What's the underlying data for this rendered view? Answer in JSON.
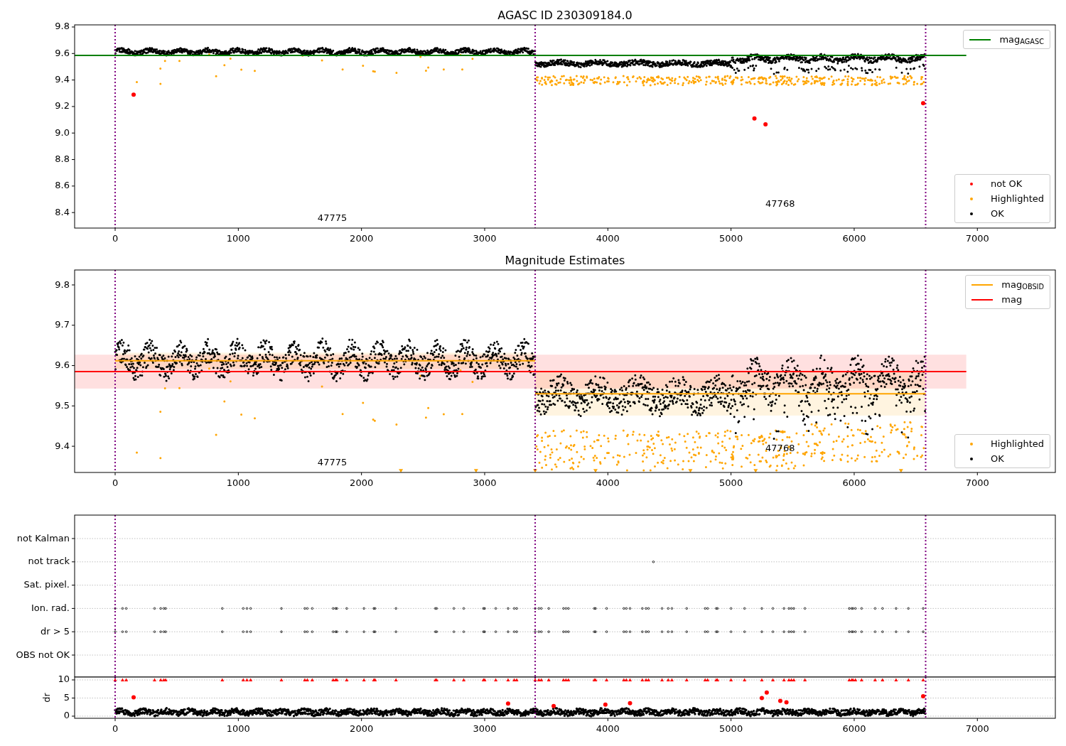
{
  "figure": {
    "panels": [
      {
        "kind": "magnitude",
        "chart_data": {
          "type": "scatter",
          "title": "AGASC ID 230309184.0",
          "xlim": [
            -329,
            7633
          ],
          "ylim": [
            8.283,
            9.816
          ],
          "xticks": [
            0,
            1000,
            2000,
            3000,
            4000,
            5000,
            6000,
            7000
          ],
          "yticks": [
            8.4,
            8.6,
            8.8,
            {
              "value": 9,
              "label": "9.0"
            },
            9.2,
            9.4,
            9.6,
            9.8
          ],
          "series": [
            {
              "type": "line",
              "color": "#008000",
              "x": [
                -329,
                6910
              ],
              "values": [
                9.585,
                9.585
              ]
            },
            {
              "color": "#ff0000",
              "x": [
                150,
                5190,
                5280,
                6560
              ],
              "values": [
                9.29,
                9.11,
                9.065,
                9.225
              ]
            }
          ],
          "ref_lines": [
            {
              "axis": "x",
              "value": 0,
              "color": "#800080"
            },
            {
              "axis": "x",
              "value": 3410,
              "color": "#800080"
            },
            {
              "axis": "x",
              "value": 6580,
              "color": "#800080"
            }
          ],
          "annotations": [
            "47775",
            "47768"
          ]
        },
        "legends": [
          {
            "items": [
              {
                "kind": "line",
                "label": "mag$_{AGASC}$",
                "color": "#008000"
              }
            ]
          },
          {
            "items": [
              {
                "kind": "point",
                "label": "not OK",
                "color": "#ff0000"
              },
              {
                "kind": "point",
                "label": "Highlighted",
                "color": "#ffa500"
              },
              {
                "kind": "point",
                "label": "OK",
                "color": "#000000"
              }
            ]
          }
        ]
      },
      {
        "kind": "estimates",
        "chart_data": {
          "type": "scatter",
          "title": "Magnitude Estimates",
          "xlim": [
            -329,
            7633
          ],
          "ylim": [
            9.335,
            9.837
          ],
          "xticks": [
            0,
            1000,
            2000,
            3000,
            4000,
            5000,
            6000,
            7000
          ],
          "yticks": [
            9.4,
            9.5,
            9.6,
            9.7,
            9.8
          ],
          "series": [
            {
              "type": "line",
              "color": "#ffa500",
              "x": [
                0,
                3410
              ],
              "values": [
                9.612,
                9.612
              ]
            },
            {
              "type": "line",
              "color": "#ffa500",
              "x": [
                3410,
                6580
              ],
              "values": [
                9.53,
                9.53
              ]
            },
            {
              "type": "line",
              "color": "#ff0000",
              "x": [
                -329,
                6910
              ],
              "values": [
                9.585,
                9.585
              ]
            }
          ],
          "bands": [
            {
              "axis": "y",
              "from": 9.592,
              "to": 9.632,
              "color": "#ffa500"
            },
            {
              "axis": "y",
              "from": 9.476,
              "to": 9.585,
              "color": "#ffa500"
            },
            {
              "axis": "y",
              "from": 9.543,
              "to": 9.627,
              "color": "#ff0000"
            }
          ],
          "ref_lines": [
            {
              "axis": "x",
              "value": 0,
              "color": "#800080"
            },
            {
              "axis": "x",
              "value": 3410,
              "color": "#800080"
            },
            {
              "axis": "x",
              "value": 6580,
              "color": "#800080"
            }
          ],
          "annotations": [
            "47775",
            "47768"
          ]
        },
        "legends": [
          {
            "items": [
              {
                "kind": "line",
                "label": "mag$_{OBSID}$",
                "color": "#ffa500"
              },
              {
                "kind": "line",
                "label": "mag",
                "color": "#ff0000"
              }
            ]
          },
          {
            "items": [
              {
                "kind": "point",
                "label": "Highlighted",
                "color": "#ffa500"
              },
              {
                "kind": "point",
                "label": "OK",
                "color": "#000000"
              }
            ]
          }
        ]
      },
      {
        "kind": "flags",
        "rows": [
          "not Kalman",
          "not track",
          "Sat. pixel.",
          "Ion. rad.",
          "dr > 5",
          "OBS not OK"
        ]
      },
      {
        "kind": "dr",
        "chart_data": {
          "type": "scatter",
          "ylabel": "dr",
          "grid": true,
          "xlim": [
            -329,
            7633
          ],
          "ylim": [
            -0.59,
            10.78
          ],
          "xticks": [
            0,
            1000,
            2000,
            3000,
            4000,
            5000,
            6000,
            7000
          ],
          "yticks": [
            0,
            5,
            10
          ],
          "series": [
            {
              "color": "#ff0000",
              "x": [
                150,
                3190,
                3560,
                3980,
                4180,
                5250,
                5290,
                5400,
                5450,
                6560
              ],
              "values": [
                5.2,
                3.5,
                2.8,
                3.2,
                3.6,
                5,
                6.5,
                4.2,
                3.8,
                5.5
              ]
            }
          ],
          "ref_lines": [
            {
              "axis": "x",
              "value": 0,
              "color": "#800080"
            },
            {
              "axis": "x",
              "value": 3410,
              "color": "#800080"
            },
            {
              "axis": "x",
              "value": 6580,
              "color": "#800080"
            }
          ]
        }
      }
    ]
  }
}
